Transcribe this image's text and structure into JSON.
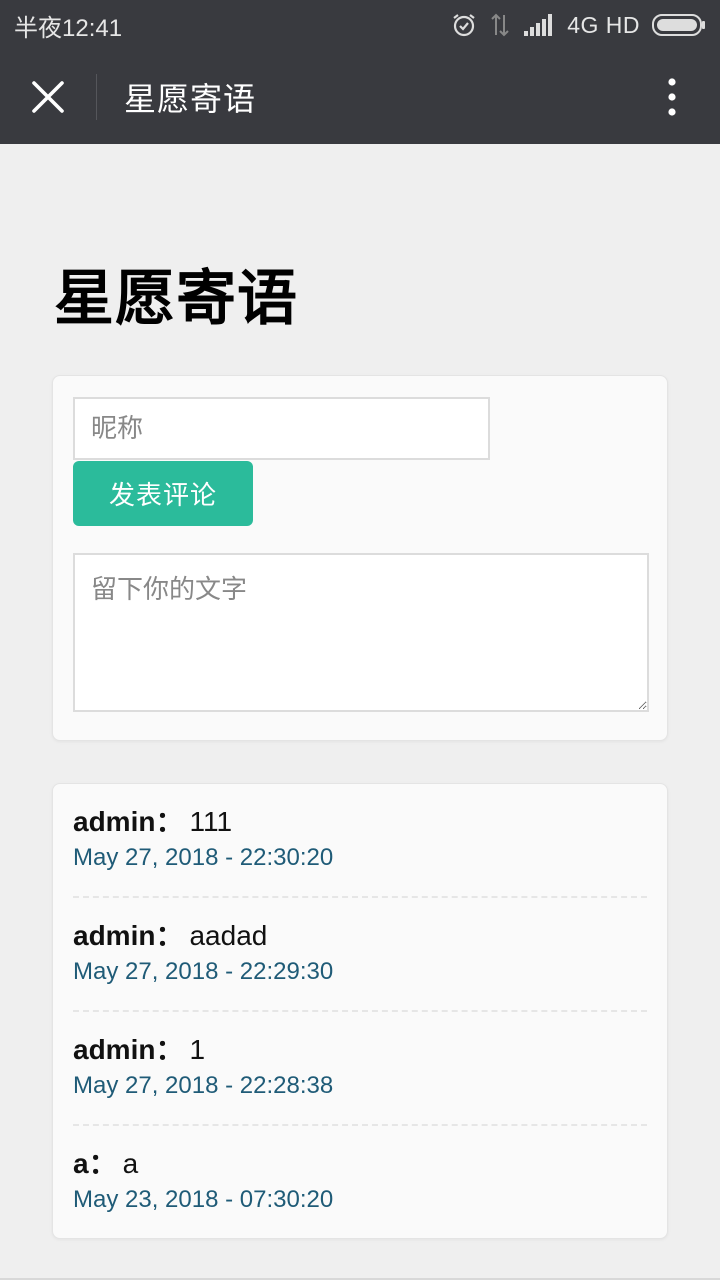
{
  "status_bar": {
    "time": "半夜12:41",
    "network": "4G HD",
    "icons": [
      "alarm-icon",
      "data-arrows-icon",
      "signal-icon",
      "battery-icon"
    ]
  },
  "title_bar": {
    "title": "星愿寄语",
    "close_icon": "close-icon",
    "more_icon": "more-vertical-icon"
  },
  "page": {
    "heading": "星愿寄语",
    "form": {
      "nickname_placeholder": "昵称",
      "nickname_value": "",
      "submit_label": "发表评论",
      "message_placeholder": "留下你的文字",
      "message_value": ""
    },
    "comments": [
      {
        "author": "admin",
        "text": "111",
        "time": "May 27, 2018 - 22:30:20"
      },
      {
        "author": "admin",
        "text": "aadad",
        "time": "May 27, 2018 - 22:29:30"
      },
      {
        "author": "admin",
        "text": "1",
        "time": "May 27, 2018 - 22:28:38"
      },
      {
        "author": "a",
        "text": "a",
        "time": "May 23, 2018 - 07:30:20"
      }
    ],
    "separator": "："
  },
  "colors": {
    "header_bg": "#393a3f",
    "button_green": "#2bbb9b",
    "time_blue": "#1f5b77",
    "page_bg": "#efefef"
  }
}
